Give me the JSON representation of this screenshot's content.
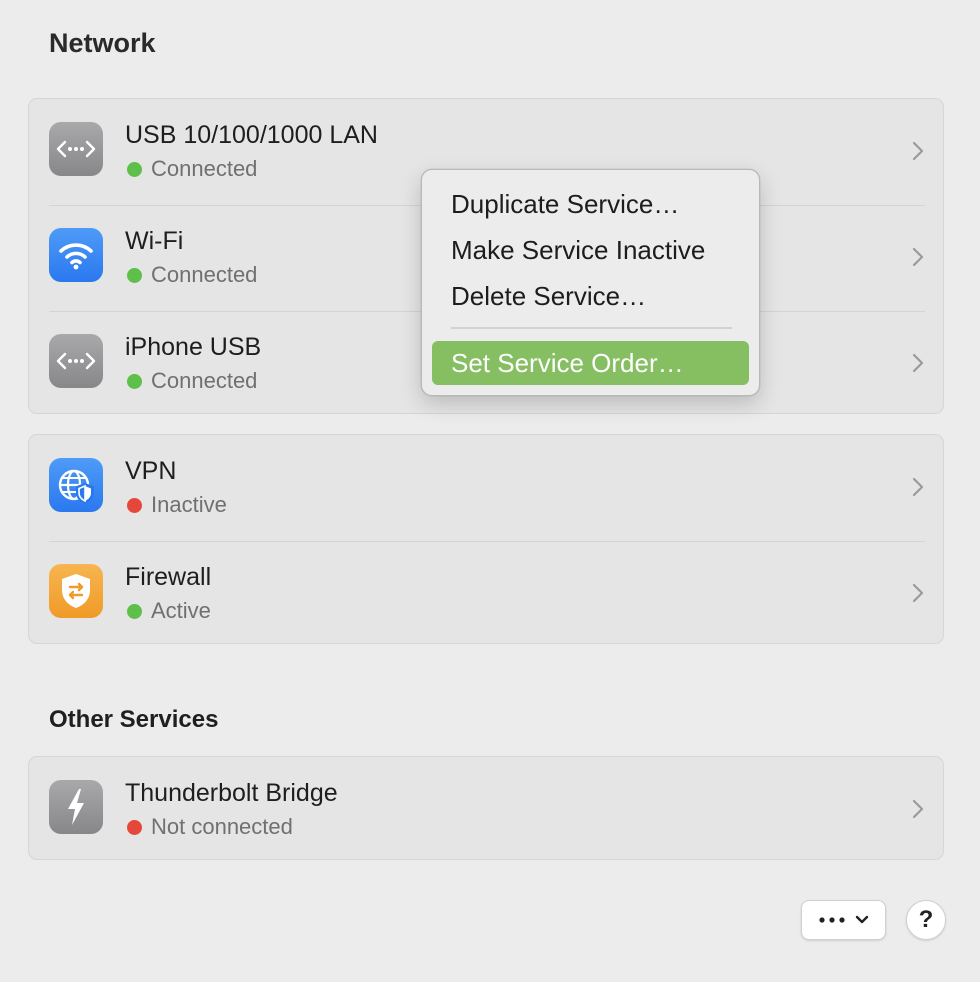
{
  "header": {
    "title": "Network"
  },
  "groups": [
    {
      "rows": [
        {
          "name": "USB 10/100/1000 LAN",
          "status": "Connected",
          "status_color": "#5ec04a",
          "icon": "ethernet-icon"
        },
        {
          "name": "Wi-Fi",
          "status": "Connected",
          "status_color": "#5ec04a",
          "icon": "wifi-icon"
        },
        {
          "name": "iPhone USB",
          "status": "Connected",
          "status_color": "#5ec04a",
          "icon": "ethernet-icon"
        }
      ]
    },
    {
      "rows": [
        {
          "name": "VPN",
          "status": "Inactive",
          "status_color": "#e5483a",
          "icon": "vpn-globe-icon"
        },
        {
          "name": "Firewall",
          "status": "Active",
          "status_color": "#5ec04a",
          "icon": "firewall-shield-icon"
        }
      ]
    }
  ],
  "other_services": {
    "title": "Other Services",
    "rows": [
      {
        "name": "Thunderbolt Bridge",
        "status": "Not connected",
        "status_color": "#e5483a",
        "icon": "thunderbolt-icon"
      }
    ]
  },
  "context_menu": {
    "items": [
      {
        "label": "Duplicate Service…"
      },
      {
        "label": "Make Service Inactive"
      },
      {
        "label": "Delete Service…"
      },
      {
        "label": "Set Service Order…",
        "highlighted": true
      }
    ],
    "highlight_color": "#86be62"
  },
  "footer": {
    "more_button_icon": "ellipsis-icon",
    "more_button_chevron": "chevron-down-icon",
    "help_label": "?"
  }
}
